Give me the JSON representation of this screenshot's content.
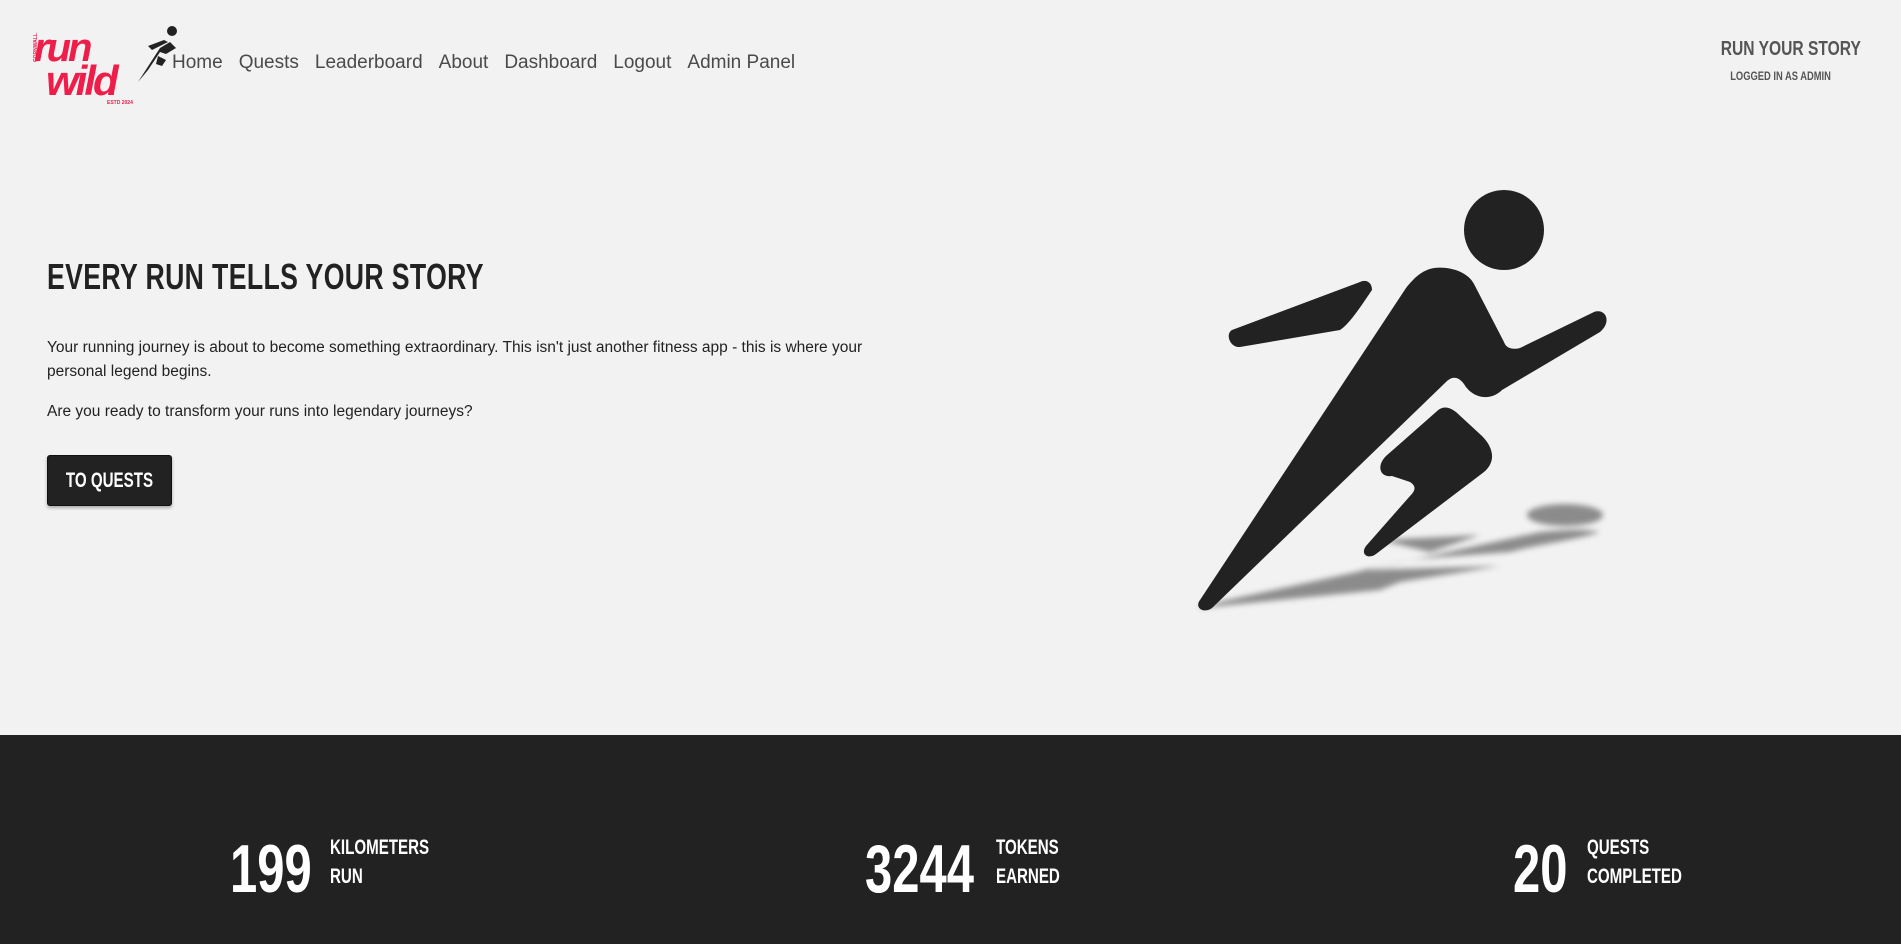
{
  "logo": {
    "word1": "run",
    "word2": "wild",
    "tiny_side": "CORNWALL",
    "tiny_bottom": "ESTD 2024",
    "brand_color": "#ee1d4a",
    "icon": "running-man-icon"
  },
  "nav": {
    "items": [
      "Home",
      "Quests",
      "Leaderboard",
      "About",
      "Dashboard",
      "Logout",
      "Admin Panel"
    ]
  },
  "header_right": {
    "title": "RUN YOUR STORY",
    "subtitle": "LOGGED IN AS ADMIN"
  },
  "hero": {
    "title": "EVERY RUN TELLS YOUR STORY",
    "paragraph1": "Your running journey is about to become something extraordinary. This isn't just another fitness app - this is where your personal legend begins.",
    "paragraph2": "Are you ready to transform your runs into legendary journeys?",
    "button_label": "TO QUESTS",
    "illustration": "running-figure-icon"
  },
  "stats": [
    {
      "value": "199",
      "label_line1": "KILOMETERS",
      "label_line2": "RUN"
    },
    {
      "value": "3244",
      "label_line1": "TOKENS",
      "label_line2": "EARNED"
    },
    {
      "value": "20",
      "label_line1": "QUESTS",
      "label_line2": "COMPLETED"
    }
  ],
  "colors": {
    "background": "#f2f2f2",
    "dark": "#222222",
    "brand": "#ee1d4a"
  }
}
